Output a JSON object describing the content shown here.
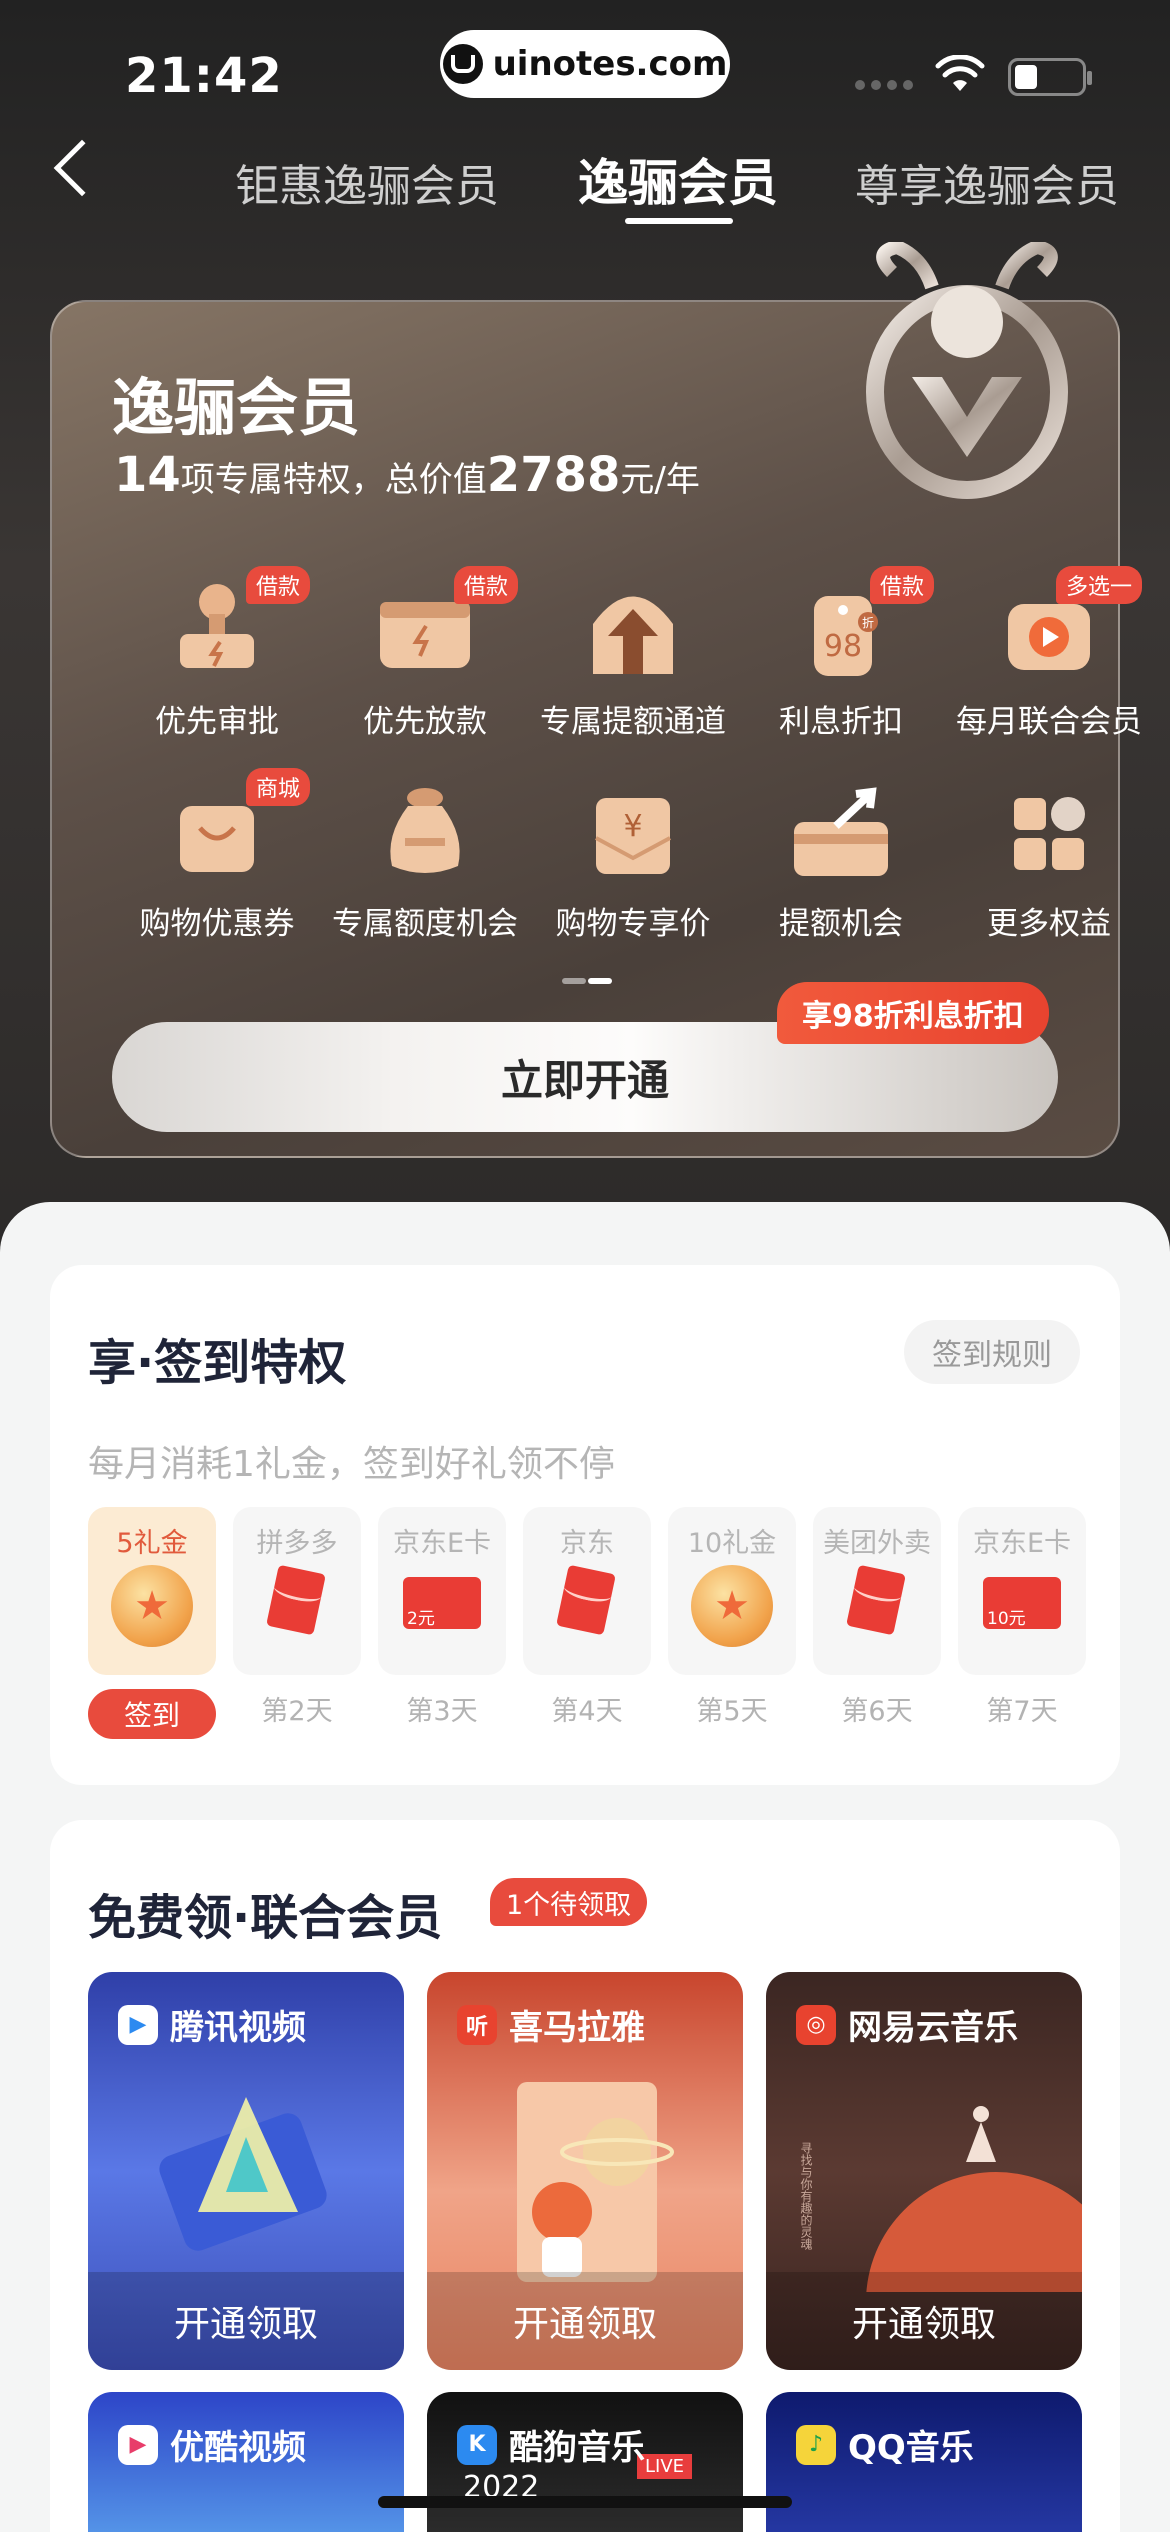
{
  "status": {
    "time": "21:42",
    "url": "uinotes.com"
  },
  "tabs": [
    {
      "label": "钜惠逸骊会员"
    },
    {
      "label": "逸骊会员"
    },
    {
      "label": "尊享逸骊会员"
    }
  ],
  "card": {
    "title": "逸骊会员",
    "sub_count": "14",
    "sub_mid": "项专属特权，总价值",
    "sub_value": "2788",
    "sub_unit": "元/年",
    "privileges": [
      {
        "label": "优先审批",
        "tag": "借款",
        "icon": "stamp-icon"
      },
      {
        "label": "优先放款",
        "tag": "借款",
        "icon": "wallet-icon"
      },
      {
        "label": "专属提额通道",
        "tag": "",
        "icon": "up-arrow-icon"
      },
      {
        "label": "利息折扣",
        "tag": "借款",
        "icon": "discount-tag-icon"
      },
      {
        "label": "每月联合会员",
        "tag": "多选一",
        "icon": "video-play-icon"
      },
      {
        "label": "购物优惠券",
        "tag": "商城",
        "icon": "shopping-bag-icon"
      },
      {
        "label": "专属额度机会",
        "tag": "",
        "icon": "money-bag-icon"
      },
      {
        "label": "购物专享价",
        "tag": "",
        "icon": "yen-envelope-icon"
      },
      {
        "label": "提额机会",
        "tag": "",
        "icon": "card-up-icon"
      },
      {
        "label": "更多权益",
        "tag": "",
        "icon": "grid-icon"
      }
    ],
    "cta_label": "立即开通",
    "cta_tag": "享98折利息折扣",
    "tag_98": "98",
    "tag_zhe": "折"
  },
  "checkin": {
    "title": "享·签到特权",
    "rules_label": "签到规则",
    "desc": "每月消耗1礼金，签到好礼领不停",
    "signin_label": "签到",
    "days": [
      {
        "name": "5礼金",
        "label": "",
        "kind": "coin",
        "amount": ""
      },
      {
        "name": "拼多多",
        "label": "第2天",
        "kind": "redpack",
        "amount": ""
      },
      {
        "name": "京东E卡",
        "label": "第3天",
        "kind": "ecard",
        "amount": "2元"
      },
      {
        "name": "京东",
        "label": "第4天",
        "kind": "redpack",
        "amount": ""
      },
      {
        "name": "10礼金",
        "label": "第5天",
        "kind": "coin",
        "amount": ""
      },
      {
        "name": "美团外卖",
        "label": "第6天",
        "kind": "redpack",
        "amount": ""
      },
      {
        "name": "京东E卡",
        "label": "第7天",
        "kind": "ecard",
        "amount": "10元"
      }
    ]
  },
  "vip_section": {
    "title": "免费领·联合会员",
    "badge": "1个待领取",
    "get_label": "开通领取",
    "cards": [
      {
        "name": "腾讯视频",
        "logo": "▶"
      },
      {
        "name": "喜马拉雅",
        "logo": "听"
      },
      {
        "name": "网易云音乐",
        "logo": "◎"
      }
    ],
    "cards2": [
      {
        "name": "优酷视频",
        "logo": "▶"
      },
      {
        "name": "酷狗音乐",
        "logo": "K"
      },
      {
        "name": "QQ音乐",
        "logo": "♪"
      }
    ],
    "kugou_year": "2022",
    "kugou_live": "LIVE",
    "netease_poem": "寻找与你有趣的灵魂"
  }
}
